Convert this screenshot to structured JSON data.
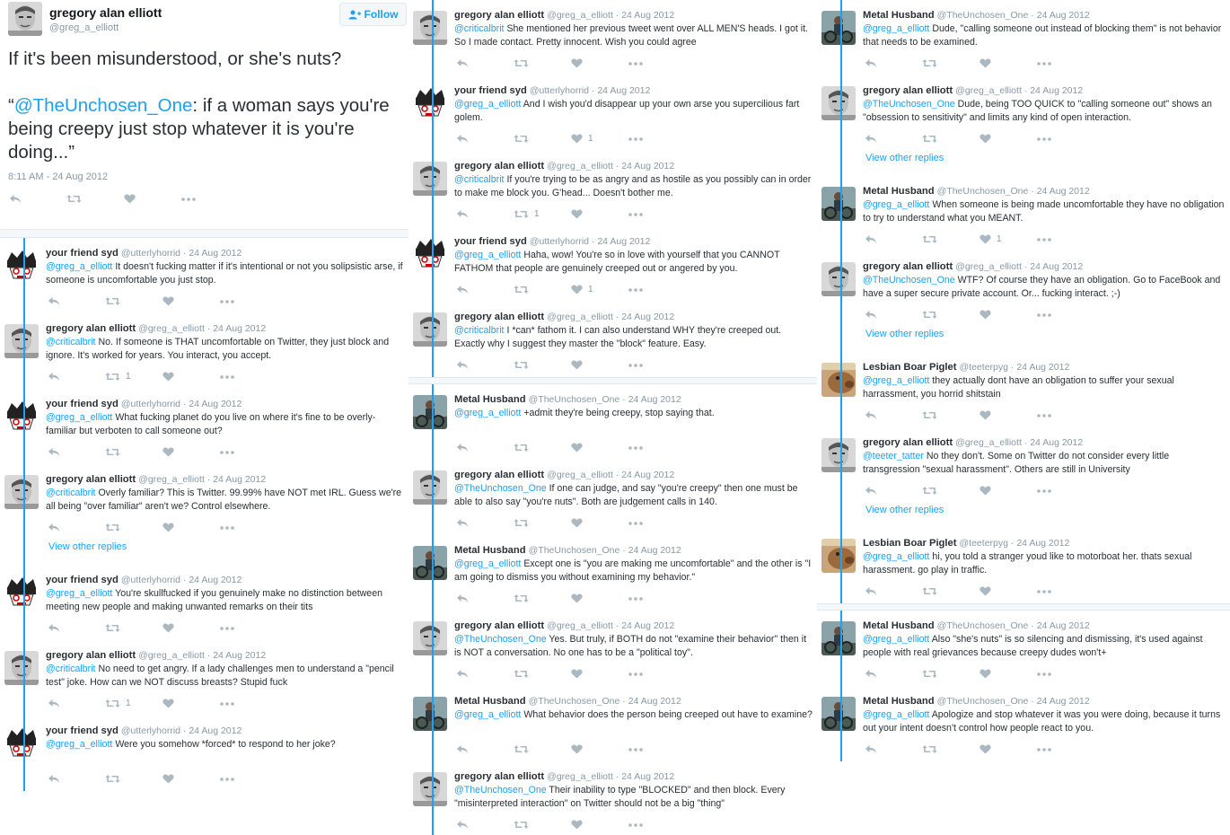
{
  "main": {
    "name": "gregory alan elliott",
    "handle": "@greg_a_elliott",
    "follow_label": "Follow",
    "text_line1": "If it's been misunderstood, or she's nuts?",
    "quote_open": "“",
    "quote_mention": "@TheUnchosen_One",
    "quote_rest": ": if a woman says you're being creepy just stop whatever it is you're doing...”",
    "time": "8:11 AM - 24 Aug 2012"
  },
  "view_other_replies": "View other replies",
  "tweets": [
    {
      "name": "your friend syd",
      "handle": "@utterlyhorrid",
      "date": "24 Aug 2012",
      "mention": "@greg_a_elliott",
      "text": " It doesn't fucking matter if it's intentional or not you solipsistic arse, if someone is uncomfortable you just stop.",
      "rt": "",
      "like": ""
    },
    {
      "name": "gregory alan elliott",
      "handle": "@greg_a_elliott",
      "date": "24 Aug 2012",
      "mention": "@criticalbrit",
      "text": " No. If someone is THAT uncomfortable on Twitter, they just block and ignore. It's worked for years. You interact, you accept.",
      "rt": "1",
      "like": ""
    },
    {
      "name": "your friend syd",
      "handle": "@utterlyhorrid",
      "date": "24 Aug 2012",
      "mention": "@greg_a_elliott",
      "text": " What fucking planet do you live on where it's fine to be overly-familiar but verboten to call someone out?",
      "rt": "",
      "like": ""
    },
    {
      "name": "gregory alan elliott",
      "handle": "@greg_a_elliott",
      "date": "24 Aug 2012",
      "mention": "@criticalbrit",
      "text": " Overly familiar? This is Twitter. 99.99% have NOT met IRL. Guess we're all being \"over familiar\" aren't we? Control elsewhere.",
      "rt": "",
      "like": ""
    },
    {
      "name": "your friend syd",
      "handle": "@utterlyhorrid",
      "date": "24 Aug 2012",
      "mention": "@greg_a_elliott",
      "text": " You're skullfucked if you genuinely make no distinction between meeting new people and making unwanted remarks on their tits",
      "rt": "",
      "like": ""
    },
    {
      "name": "gregory alan elliott",
      "handle": "@greg_a_elliott",
      "date": "24 Aug 2012",
      "mention": "@criticalbrit",
      "text": " No need to get angry. If a lady challenges men to understand a \"pencil test\" joke. How can we NOT discuss breasts? Stupid fuck",
      "rt": "1",
      "like": ""
    },
    {
      "name": "your friend syd",
      "handle": "@utterlyhorrid",
      "date": "24 Aug 2012",
      "mention": "@greg_a_elliott",
      "text": " Were you somehow *forced* to respond to her joke?",
      "rt": "",
      "like": ""
    },
    {
      "name": "gregory alan elliott",
      "handle": "@greg_a_elliott",
      "date": "24 Aug 2012",
      "mention": "@criticalbrit",
      "text": " She mentioned her previous tweet went over ALL MEN'S heads. I got it. So I made contact. Pretty innocent. Wish you could agree",
      "rt": "",
      "like": ""
    },
    {
      "name": "your friend syd",
      "handle": "@utterlyhorrid",
      "date": "24 Aug 2012",
      "mention": "@greg_a_elliott",
      "text": "  And I wish you'd disappear up your own arse you supercilious fart golem.",
      "rt": "",
      "like": "1"
    },
    {
      "name": "gregory alan elliott",
      "handle": "@greg_a_elliott",
      "date": "24 Aug 2012",
      "mention": "@criticalbrit",
      "text": " If you're trying to be as angry and as hostile as you possibly can in order to make me block you. G'head... Doesn't bother me.",
      "rt": "1",
      "like": ""
    },
    {
      "name": "your friend syd",
      "handle": "@utterlyhorrid",
      "date": "24 Aug 2012",
      "mention": "@greg_a_elliott",
      "text": " Haha, wow! You're so in love with yourself that you CANNOT FATHOM that people are genuinely creeped out or angered by you.",
      "rt": "",
      "like": "1"
    },
    {
      "name": "gregory alan elliott",
      "handle": "@greg_a_elliott",
      "date": "24 Aug 2012",
      "mention": "@criticalbrit",
      "text": " I *can* fathom it. I can also understand WHY they're creeped out. Exactly why I suggest they master the \"block\" feature. Easy.",
      "rt": "",
      "like": ""
    },
    {
      "name": "Metal Husband",
      "handle": "@TheUnchosen_One",
      "date": "24 Aug 2012",
      "mention": "@greg_a_elliott",
      "text": " +admit they're being creepy, stop saying that.",
      "rt": "",
      "like": ""
    },
    {
      "name": "gregory alan elliott",
      "handle": "@greg_a_elliott",
      "date": "24 Aug 2012",
      "mention": "@TheUnchosen_One",
      "text": " If one can judge, and say \"you're creepy\" then one must be able to also say \"you're nuts\". Both are judgement calls in 140.",
      "rt": "",
      "like": ""
    },
    {
      "name": "Metal Husband",
      "handle": "@TheUnchosen_One",
      "date": "24 Aug 2012",
      "mention": "@greg_a_elliott",
      "text": " Except one is \"you are making me uncomfortable\" and the other is \"I am going to dismiss you without examining my behavior.\"",
      "rt": "",
      "like": ""
    },
    {
      "name": "gregory alan elliott",
      "handle": "@greg_a_elliott",
      "date": "24 Aug 2012",
      "mention": "@TheUnchosen_One",
      "text": " Yes. But truly, if BOTH do not \"examine their behavior\" then it is NOT a conversation. No one has to be a \"political toy\".",
      "rt": "",
      "like": ""
    },
    {
      "name": "Metal Husband",
      "handle": "@TheUnchosen_One",
      "date": "24 Aug 2012",
      "mention": "@greg_a_elliott",
      "text": " What behavior does the person being creeped out have to examine?",
      "rt": "",
      "like": ""
    },
    {
      "name": "gregory alan elliott",
      "handle": "@greg_a_elliott",
      "date": "24 Aug 2012",
      "mention": "@TheUnchosen_One",
      "text": " Their inability to type \"BLOCKED\" and then block. Every \"misinterpreted interaction\" on Twitter should not be a big \"thing\"",
      "rt": "",
      "like": ""
    },
    {
      "name": "Metal Husband",
      "handle": "@TheUnchosen_One",
      "date": "24 Aug 2012",
      "mention": "@greg_a_elliott",
      "text": " Dude, \"calling someone out instead of blocking them\" is not behavior that needs to be examined.",
      "rt": "",
      "like": ""
    },
    {
      "name": "gregory alan elliott",
      "handle": "@greg_a_elliott",
      "date": "24 Aug 2012",
      "mention": "@TheUnchosen_One",
      "text": " Dude, being TOO QUICK to \"calling someone out\" shows an \"obsession to sensitivity\" and limits any kind of open interaction.",
      "rt": "",
      "like": ""
    },
    {
      "name": "Metal Husband",
      "handle": "@TheUnchosen_One",
      "date": "24 Aug 2012",
      "mention": "@greg_a_elliott",
      "text": " When someone is being made uncomfortable they have no obligation to try to understand what you MEANT.",
      "rt": "",
      "like": "1"
    },
    {
      "name": "gregory alan elliott",
      "handle": "@greg_a_elliott",
      "date": "24 Aug 2012",
      "mention": "@TheUnchosen_One",
      "text": " WTF? Of course they have an obligation. Go to FaceBook and have a super secure private account. Or... fucking interact. ;-)",
      "rt": "",
      "like": ""
    },
    {
      "name": "Lesbian Boar Piglet",
      "handle": "@teeterpyg",
      "date": "24 Aug 2012",
      "mention": "@greg_a_elliott",
      "text": " they actually dont have an obligation to suffer your sexual harrassment, you horrid shitstain",
      "rt": "",
      "like": ""
    },
    {
      "name": "gregory alan elliott",
      "handle": "@greg_a_elliott",
      "date": "24 Aug 2012",
      "mention": "@teeter_tatter",
      "text": " No they don't. Some on Twitter do not consider every little transgression \"sexual harassment\". Others are still in University",
      "rt": "",
      "like": ""
    },
    {
      "name": "Lesbian Boar Piglet",
      "handle": "@teeterpyg",
      "date": "24 Aug 2012",
      "mention": "@greg_a_elliott",
      "text": " hi, you told a stranger youd like to motorboat her. thats sexual harassment. go play in traffic.",
      "rt": "",
      "like": ""
    },
    {
      "name": "Metal Husband",
      "handle": "@TheUnchosen_One",
      "date": "24 Aug 2012",
      "mention": "@greg_a_elliott",
      "text": " Also \"she's nuts\" is so silencing and dismissing, it's used against people with real grievances because creepy dudes won't+",
      "rt": "",
      "like": ""
    },
    {
      "name": "Metal Husband",
      "handle": "@TheUnchosen_One",
      "date": "24 Aug 2012",
      "mention": "@greg_a_elliott",
      "text": " Apologize and stop whatever it was you were doing, because it turns out your intent doesn't control how people react to you.",
      "rt": "",
      "like": ""
    }
  ]
}
